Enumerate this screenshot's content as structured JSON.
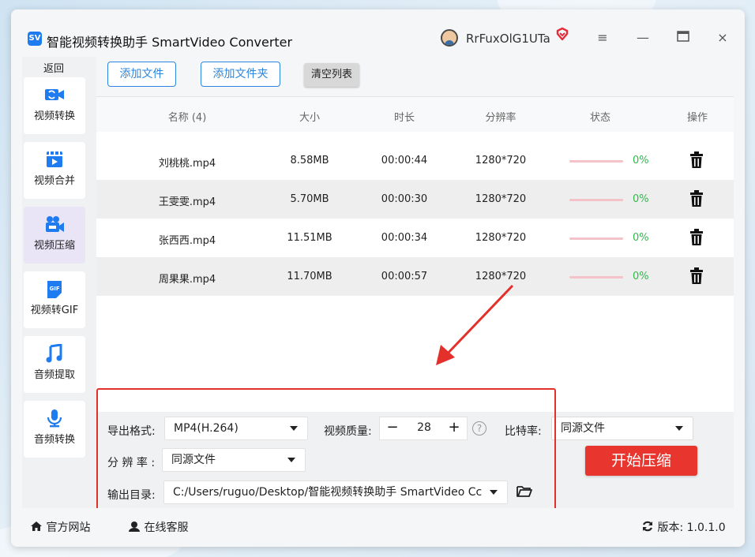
{
  "app": {
    "title": "智能视频转换助手 SmartVideo Converter",
    "logo_text": "SV",
    "username": "RrFuxOlG1UTa"
  },
  "window_controls": {
    "menu": "≡",
    "minimize": "—",
    "maximize": "▭",
    "close": "×"
  },
  "sidebar": {
    "back_label": "返回",
    "items": [
      {
        "label": "视频转换",
        "icon": "video-convert-icon",
        "active": false
      },
      {
        "label": "视频合并",
        "icon": "video-merge-icon",
        "active": false
      },
      {
        "label": "视频压缩",
        "icon": "video-compress-icon",
        "active": true
      },
      {
        "label": "视频转GIF",
        "icon": "gif-icon",
        "active": false
      },
      {
        "label": "音频提取",
        "icon": "music-note-icon",
        "active": false
      },
      {
        "label": "音频转换",
        "icon": "microphone-icon",
        "active": false
      }
    ]
  },
  "toolbar": {
    "add_file": "添加文件",
    "add_folder": "添加文件夹",
    "clear_list": "清空列表"
  },
  "table": {
    "headers": {
      "name": "名称 (4)",
      "size": "大小",
      "duration": "时长",
      "resolution": "分辨率",
      "status": "状态",
      "action": "操作"
    },
    "rows": [
      {
        "name": "刘桃桃.mp4",
        "size": "8.58MB",
        "duration": "00:00:44",
        "resolution": "1280*720",
        "progress": 0,
        "percent": "0%"
      },
      {
        "name": "王雯雯.mp4",
        "size": "5.70MB",
        "duration": "00:00:30",
        "resolution": "1280*720",
        "progress": 0,
        "percent": "0%"
      },
      {
        "name": "张西西.mp4",
        "size": "11.51MB",
        "duration": "00:00:34",
        "resolution": "1280*720",
        "progress": 0,
        "percent": "0%"
      },
      {
        "name": "周果果.mp4",
        "size": "11.70MB",
        "duration": "00:00:57",
        "resolution": "1280*720",
        "progress": 0,
        "percent": "0%"
      }
    ]
  },
  "settings": {
    "format_label": "导出格式:",
    "format_value": "MP4(H.264)",
    "quality_label": "视频质量:",
    "quality_minus": "−",
    "quality_value": "28",
    "quality_plus": "+",
    "quality_help": "?",
    "bitrate_label": "比特率:",
    "bitrate_value": "同源文件",
    "resolution_label": "分 辨 率 :",
    "resolution_value": "同源文件",
    "output_label": "输出目录:",
    "output_value": "C:/Users/ruguo/Desktop/智能视频转换助手 SmartVideo Cc",
    "start_button": "开始压缩"
  },
  "footer": {
    "website": "官方网站",
    "support": "在线客服",
    "version": "版本: 1.0.1.0"
  },
  "colors": {
    "accent": "#2a86e0",
    "start_button": "#e8362f",
    "highlight_box": "#e3302b",
    "progress_track": "#f4c2c9",
    "percent_text": "#2fb94b",
    "active_nav": "#e9e4f6",
    "icon_blue": "#1e7cf0"
  }
}
